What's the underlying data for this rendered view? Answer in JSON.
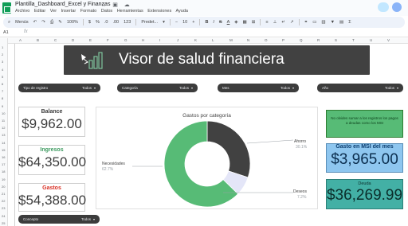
{
  "window": {
    "doc_title": "Plantilla_Dashboard_Excel y Finanzas",
    "menu": [
      "Archivo",
      "Editar",
      "Ver",
      "Insertar",
      "Formato",
      "Datos",
      "Herramientas",
      "Extensiones",
      "Ayuda"
    ]
  },
  "toolbar": {
    "search_label": "Menús",
    "zoom": "100%",
    "currency": "$",
    "percent": "%",
    "decimals_less": ".0",
    "decimals_more": ".00",
    "number_format": "123",
    "font": "Predet...",
    "font_size": "10",
    "bold": "B",
    "italic": "I",
    "strike": "S",
    "text_color": "A"
  },
  "formula_bar": {
    "cell_ref": "A1",
    "fx": "fx"
  },
  "grid": {
    "columns": [
      "A",
      "B",
      "C",
      "D",
      "E",
      "F",
      "G",
      "H",
      "I",
      "J",
      "K",
      "L",
      "M",
      "N",
      "O",
      "P",
      "Q",
      "R",
      "S",
      "T",
      "U",
      "V"
    ],
    "rows": [
      "1",
      "2",
      "3",
      "4",
      "5",
      "6",
      "7",
      "8",
      "9",
      "10",
      "11",
      "12",
      "13",
      "14",
      "15",
      "16",
      "17",
      "18",
      "19",
      "20",
      "21",
      "22",
      "23",
      "24",
      "25"
    ]
  },
  "banner": {
    "title": "Visor de salud financiera"
  },
  "filters": [
    {
      "label": "Tipo de registro",
      "value": "Todos"
    },
    {
      "label": "Categoría",
      "value": "Todos"
    },
    {
      "label": "Mes",
      "value": "Todos"
    },
    {
      "label": "Año",
      "value": "Todos"
    },
    {
      "label": "Concepto",
      "value": "Todos"
    }
  ],
  "kpis": {
    "balance": {
      "label": "Balance",
      "value": "$9,962.00",
      "color": "#3c3c3c"
    },
    "ingresos": {
      "label": "Ingresos",
      "value": "$64,350.00",
      "color": "#3c9a5f"
    },
    "gastos": {
      "label": "Gastos",
      "value": "$54,388.00",
      "color": "#d93025"
    }
  },
  "chart_data": {
    "type": "pie",
    "title": "Gastos por categoría",
    "donut": true,
    "slices": [
      {
        "name": "Ahorro",
        "value": 30.1,
        "label": "30.1%",
        "color": "#414141"
      },
      {
        "name": "Deseos",
        "value": 7.2,
        "label": "7.2%",
        "color": "#e4e6f8"
      },
      {
        "name": "Necesidades",
        "value": 62.7,
        "label": "62.7%",
        "color": "#57bb76"
      }
    ]
  },
  "right_panel": {
    "note": "No olvides sumar a los registros los pagos a deudas como los MSI",
    "msi": {
      "label": "Gasto en MSI del mes",
      "value": "$3,965.00"
    },
    "deuda": {
      "label": "Deuda",
      "value": "$36,269.99"
    }
  }
}
